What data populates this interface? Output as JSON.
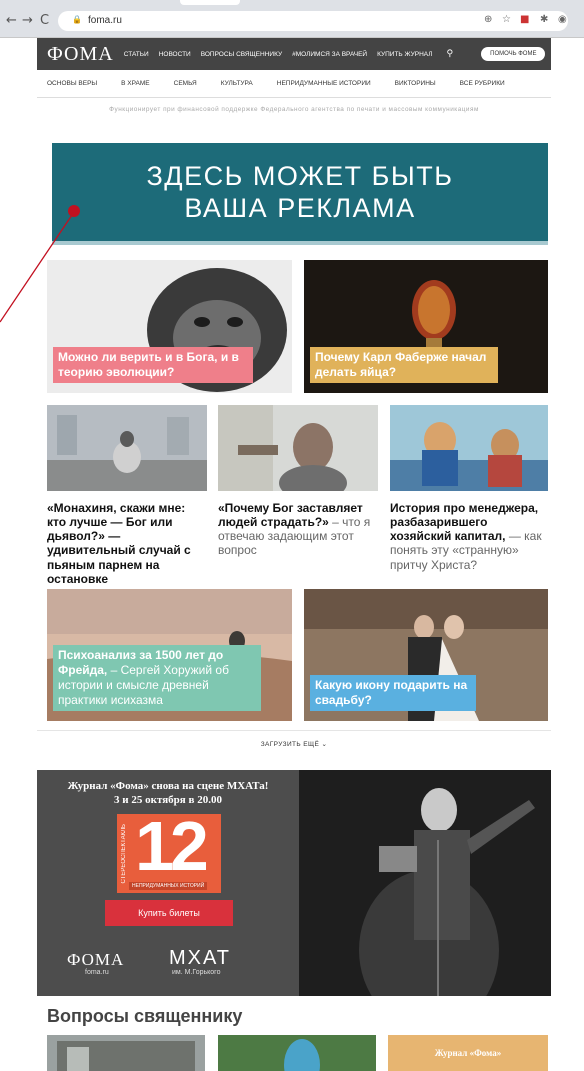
{
  "browser": {
    "url": "foma.ru",
    "back": "←",
    "forward": "→",
    "reload": "C"
  },
  "header": {
    "logo": "ФОМА",
    "nav": [
      "СТАТЬИ",
      "НОВОСТИ",
      "ВОПРОСЫ СВЯЩЕННИКУ",
      "#МОЛИМСЯ ЗА ВРАЧЕЙ",
      "КУПИТЬ ЖУРНАЛ"
    ],
    "help_button": "ПОМОЧЬ ФОМЕ"
  },
  "subnav": [
    "ОСНОВЫ ВЕРЫ",
    "В ХРАМЕ",
    "СЕМЬЯ",
    "КУЛЬТУРА",
    "НЕПРИДУМАННЫЕ ИСТОРИИ",
    "ВИКТОРИНЫ",
    "ВСЕ РУБРИКИ"
  ],
  "funding_note": "Функционирует при финансовой поддержке Федерального агентства по печати и массовым коммуникациям",
  "ad": {
    "line1": "ЗДЕСЬ МОЖЕТ БЫТЬ",
    "line2": "ВАША РЕКЛАМА"
  },
  "articles_big": [
    {
      "title": "Можно ли верить и в Бога, и в теорию эволюции?",
      "color": "#ef7f8a"
    },
    {
      "title": "Почему Карл Фаберже начал делать яйца?",
      "color": "#e0b25a"
    }
  ],
  "articles_small": [
    {
      "title": "«Монахиня, скажи мне: кто лучше — Бог или дьявол?» — удивительный случай с пьяным парнем на остановке",
      "sub": ""
    },
    {
      "title": "«Почему Бог заставляет людей страдать?»",
      "sub": " – что я отвечаю задающим этот вопрос"
    },
    {
      "title": "История про менеджера, разбазарившего хозяйский капитал,",
      "sub": " — как понять эту «странную» притчу Христа?"
    }
  ],
  "articles_big2": [
    {
      "title": "Психоанализ за 1500 лет до Фрейда,",
      "sub": " – Сергей Хоружий об истории и смысле древней практики исихазма",
      "color": "#7fc7b1"
    },
    {
      "title": "Какую икону подарить на свадьбу?",
      "sub": "",
      "color": "#5ab0e0"
    }
  ],
  "load_more": "ЗАГРУЗИТЬ ЕЩЁ ⌄",
  "banner": {
    "line1": "Журнал «Фома» снова на сцене МХАТа!",
    "line2": "3 и 25 октября в 20.00",
    "poster_number": "12",
    "poster_side": "СТЕРЕОСПЕКТАКЛЬ",
    "poster_bottom": "НЕПРИДУМАННЫХ ИСТОРИЙ",
    "buy": "Купить билеты",
    "logo1": "ФОМА",
    "logo1_sub": "foma.ru",
    "logo2": "МХАТ",
    "logo2_sub": "им. М.Горького"
  },
  "section_title": "Вопросы священнику",
  "bottom_card": "Журнал «Фома»"
}
